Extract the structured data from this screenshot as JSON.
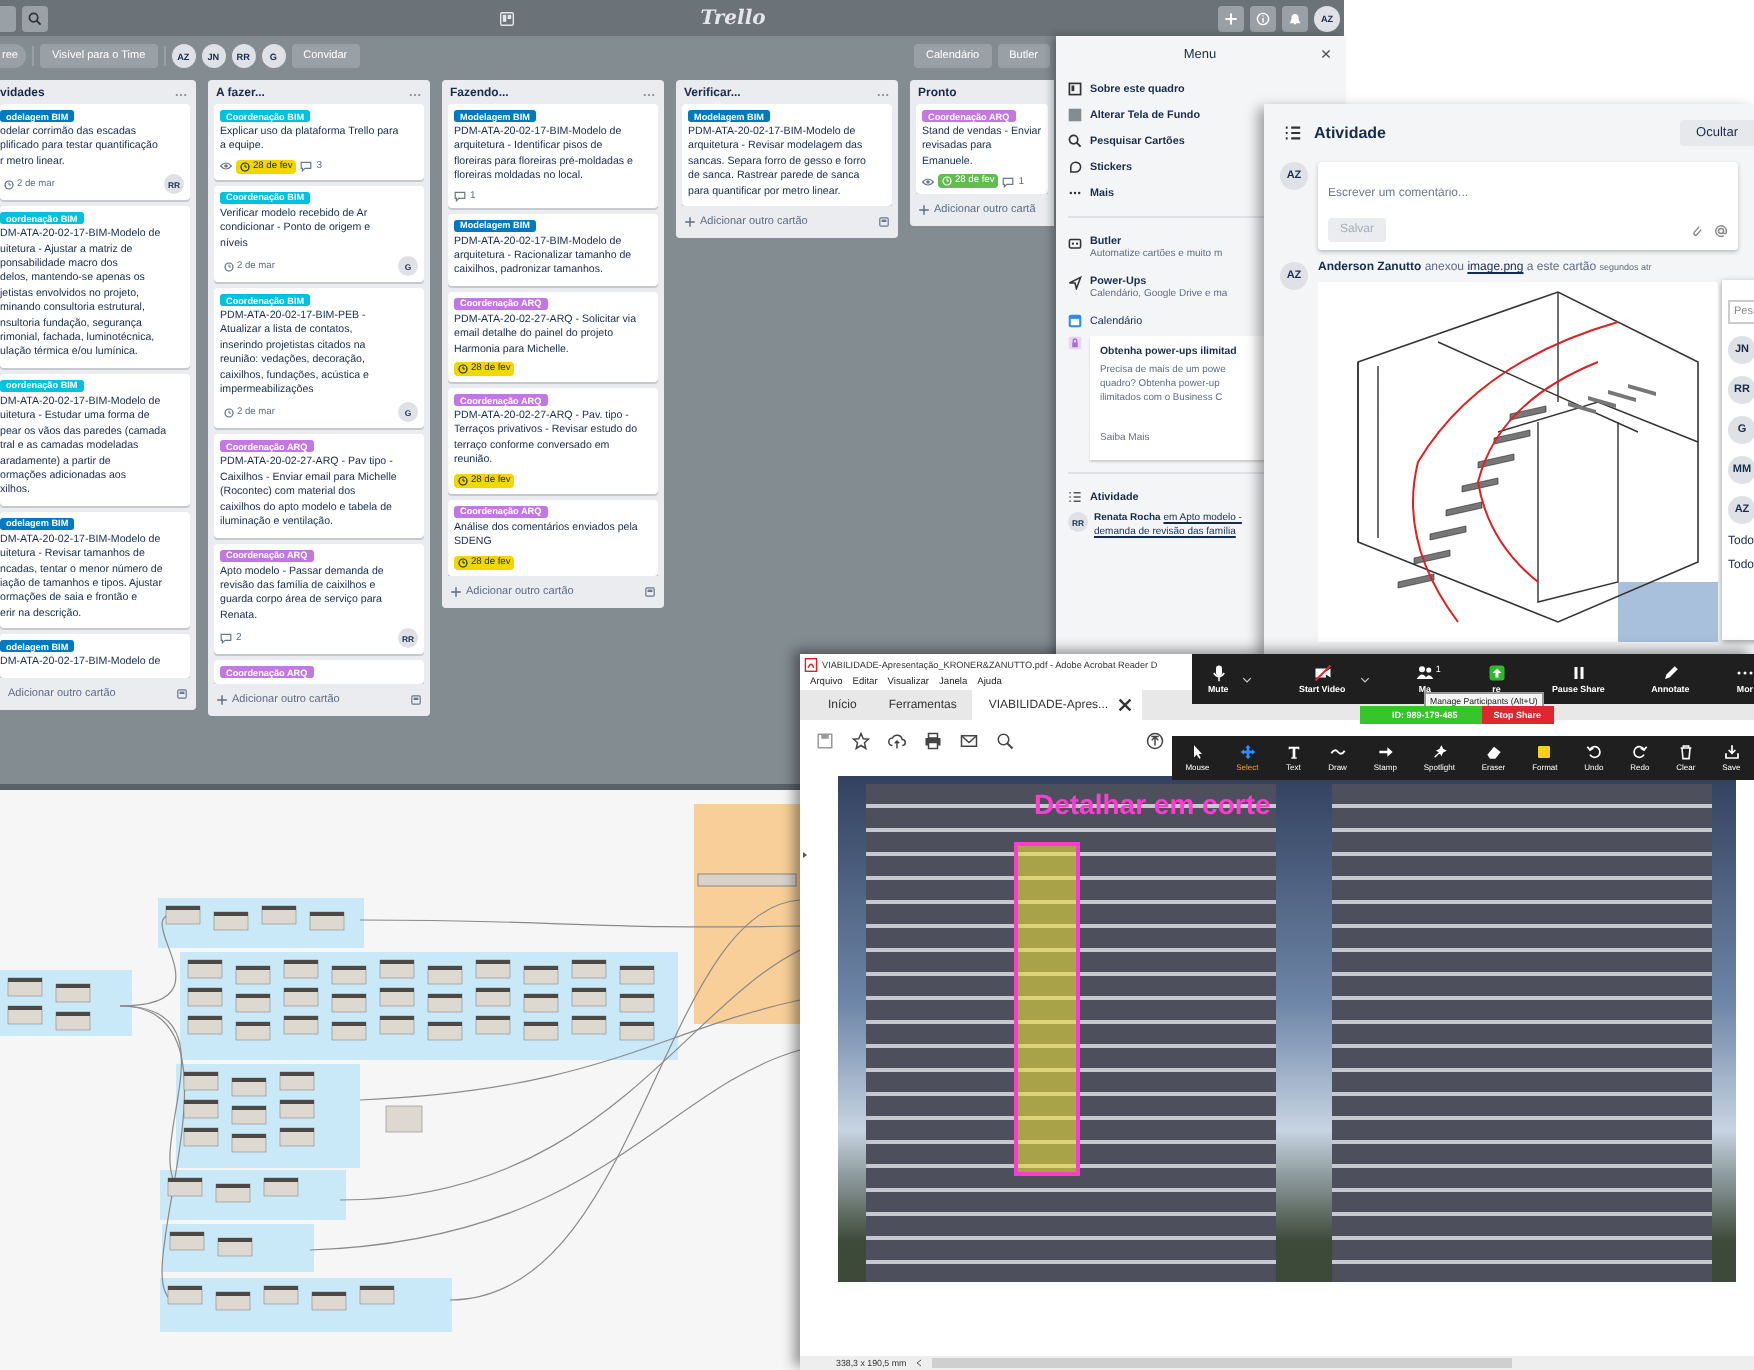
{
  "trello": {
    "header": {
      "logo": "Trello",
      "avatar": "AZ"
    },
    "board_bar": {
      "cut_button": "ree",
      "visibility": "Visível para o Time",
      "members": [
        "AZ",
        "JN",
        "RR",
        "G"
      ],
      "invite": "Convidar",
      "calendar": "Calendário",
      "butler": "Butler"
    },
    "lists": [
      {
        "title": "vidades",
        "plus": false,
        "add": "Adicionar outro cartão",
        "cards": [
          {
            "label": {
              "text": "odelagem BIM",
              "color": "#0079bf"
            },
            "text": "odelar corrimão das escadas\nplificado para testar quantificação\nr metro linear.",
            "due": {
              "text": "2 de mar",
              "kind": "plain"
            },
            "member": "RR"
          },
          {
            "label": {
              "text": "oordenação BIM",
              "color": "#00c2e0"
            },
            "text": "DM-ATA-20-02-17-BIM-Modelo de\nuitetura - Ajustar a matriz de\nponsabilidade macro dos\ndelos, mantendo-se apenas os\njetistas envolvidos no projeto,\nminando consultoria estrutural,\nnsultoria fundação, segurança\nrimonial, fachada, luminotécnica,\nulação térmica e/ou lumínica."
          },
          {
            "label": {
              "text": "oordenação BIM",
              "color": "#00c2e0"
            },
            "text": "DM-ATA-20-02-17-BIM-Modelo de\nuitetura - Estudar uma forma de\npear os vãos das paredes (camada\ntral e as camadas modeladas\naradamente) a partir de\normações adicionadas aos\nxilhos."
          },
          {
            "label": {
              "text": "odelagem BIM",
              "color": "#0079bf"
            },
            "text": "DM-ATA-20-02-17-BIM-Modelo de\nuitetura - Revisar tamanhos de\nncadas, tentar o menor número de\niação de tamanhos e tipos. Ajustar\normações de saia e frontão e\nerir na descrição."
          },
          {
            "label": {
              "text": "odelagem BIM",
              "color": "#0079bf"
            },
            "text": "DM-ATA-20-02-17-BIM-Modelo de"
          }
        ]
      },
      {
        "title": "A fazer...",
        "plus": true,
        "add": "Adicionar outro cartão",
        "cards": [
          {
            "label": {
              "text": "Coordenação BIM",
              "color": "#00c2e0"
            },
            "text": "Explicar uso da plataforma Trello para\na equipe.",
            "watch": true,
            "due": {
              "text": "28 de fev",
              "kind": "soon"
            },
            "comments": "3"
          },
          {
            "label": {
              "text": "Coordenação BIM",
              "color": "#00c2e0"
            },
            "text": "Verificar modelo recebido de Ar\ncondicionar - Ponto de origem e\nníveis",
            "due": {
              "text": "2 de mar",
              "kind": "plain"
            },
            "member": "G"
          },
          {
            "label": {
              "text": "Coordenação BIM",
              "color": "#00c2e0"
            },
            "text": "PDM-ATA-20-02-17-BIM-PEB -\nAtualizar a lista de contatos,\ninserindo projetistas citados na\nreunião: vedações, decoração,\ncaixilhos, fundações, acústica e\nimpermeabilizações",
            "due": {
              "text": "2 de mar",
              "kind": "plain"
            },
            "member": "G"
          },
          {
            "label": {
              "text": "Coordenação ARQ",
              "color": "#c377e0"
            },
            "text": "PDM-ATA-20-02-27-ARQ - Pav tipo -\nCaixilhos - Enviar email para Michelle\n(Rocontec) com material dos\ncaixilhos do apto modelo e tabela de\niluminação e ventilação."
          },
          {
            "label": {
              "text": "Coordenação ARQ",
              "color": "#c377e0"
            },
            "text": "Apto modelo - Passar demanda de\nrevisão das família de caixilhos e\nguarda corpo área de serviço para\nRenata.",
            "comments": "2",
            "member": "RR"
          },
          {
            "label": {
              "text": "Coordenação ARQ",
              "color": "#c377e0"
            }
          }
        ]
      },
      {
        "title": "Fazendo...",
        "plus": true,
        "add": "Adicionar outro cartão",
        "cards": [
          {
            "label": {
              "text": "Modelagem BIM",
              "color": "#0079bf"
            },
            "text": "PDM-ATA-20-02-17-BIM-Modelo de\narquitetura - Identificar pisos de\nfloreiras para floreiras pré-moldadas e\nfloreiras moldadas no local.",
            "comments": "1"
          },
          {
            "label": {
              "text": "Modelagem BIM",
              "color": "#0079bf"
            },
            "text": "PDM-ATA-20-02-17-BIM-Modelo de\narquitetura - Racionalizar tamanho de\ncaixilhos, padronizar tamanhos."
          },
          {
            "label": {
              "text": "Coordenação ARQ",
              "color": "#c377e0"
            },
            "text": "PDM-ATA-20-02-27-ARQ - Solicitar via\nemail detalhe do painel do projeto\nHarmonia para Michelle.",
            "due": {
              "text": "28 de fev",
              "kind": "soon"
            }
          },
          {
            "label": {
              "text": "Coordenação ARQ",
              "color": "#c377e0"
            },
            "text": "PDM-ATA-20-02-27-ARQ - Pav. tipo -\nTerraços privativos - Revisar estudo do\nterraço conforme conversado em\nreunião.",
            "due": {
              "text": "28 de fev",
              "kind": "soon"
            }
          },
          {
            "label": {
              "text": "Coordenação ARQ",
              "color": "#c377e0"
            },
            "text": "Análise dos comentários enviados pela\nSDENG",
            "due": {
              "text": "28 de fev",
              "kind": "soon"
            }
          }
        ]
      },
      {
        "title": "Verificar...",
        "plus": true,
        "add": "Adicionar outro cartão",
        "cards": [
          {
            "label": {
              "text": "Modelagem BIM",
              "color": "#0079bf"
            },
            "text": "PDM-ATA-20-02-17-BIM-Modelo de\narquitetura - Revisar modelagem das\nsancas. Separa forro de gesso e forro\nde sanca. Rastrear parede de sanca\npara quantificar por metro linear."
          }
        ]
      },
      {
        "title": "Pronto",
        "plus": true,
        "add": "Adicionar outro cartã",
        "cards": [
          {
            "label": {
              "text": "Coordenação ARQ",
              "color": "#c377e0"
            },
            "text": "Stand de vendas - Enviar\nrevisadas para Emanuele.",
            "watch": true,
            "due": {
              "text": "28 de fev",
              "kind": "done"
            },
            "comments": "1"
          }
        ]
      }
    ],
    "menu": {
      "title": "Menu",
      "items": [
        {
          "kind": "board",
          "label": "Sobre este quadro"
        },
        {
          "kind": "swatch",
          "label": "Alterar Tela de Fundo"
        },
        {
          "kind": "search",
          "label": "Pesquisar Cartões"
        },
        {
          "kind": "sticker",
          "label": "Stickers"
        },
        {
          "kind": "dots",
          "label": "Mais"
        }
      ],
      "sections": [
        {
          "kind": "robot",
          "title": "Butler",
          "subtitle": "Automatize cartões e muito m"
        },
        {
          "kind": "rocket",
          "title": "Power-Ups",
          "subtitle": "Calendário, Google Drive e ma"
        }
      ],
      "calendar": "Calendário",
      "promo": {
        "title": "Obtenha power-ups ilimitad",
        "text": "Precisa de mais de um powe\nquadro? Obtenha power-up\nilimitados com o Business C",
        "link": "Saiba Mais"
      },
      "activity": {
        "title": "Atividade",
        "avatar": "RR",
        "author": "Renata Rocha",
        "text": "em Apto modelo -\ndemanda de revisão das família"
      }
    }
  },
  "activity_window": {
    "title": "Atividade",
    "hide_button": "Ocultar",
    "comment": {
      "avatar": "AZ",
      "placeholder": "Escrever um comentário...",
      "save": "Salvar"
    },
    "entry": {
      "avatar": "AZ",
      "author": "Anderson Zanutto",
      "action": "anexou",
      "link": "image.png",
      "rest": "a este cartão",
      "time": "segundos atr"
    },
    "members_popup": {
      "search_placeholder": "Pes",
      "members": [
        "JN",
        "RR",
        "G",
        "MM",
        "AZ"
      ],
      "options": [
        "Todo",
        "Todo"
      ]
    }
  },
  "acrobat": {
    "title": "VIABILIDADE-Apresentação_KRONER&ZANUTTO.pdf - Adobe Acrobat Reader D",
    "menu": [
      "Arquivo",
      "Editar",
      "Visualizar",
      "Janela",
      "Ajuda"
    ],
    "tabs": [
      {
        "label": "Início",
        "selected": false
      },
      {
        "label": "Ferramentas",
        "selected": false
      },
      {
        "label": "VIABILIDADE-Apres...",
        "selected": true
      }
    ],
    "annotation": "Detalhar em corte",
    "page_size": "338,3 x 190,5 mm"
  },
  "zoom_controls": {
    "buttons": [
      {
        "kind": "mic",
        "label": "Mute",
        "caret": true
      },
      {
        "kind": "video-off",
        "label": "Start Video",
        "caret": true
      },
      {
        "kind": "participants",
        "label": "Ma",
        "count": "1",
        "caret": false
      },
      {
        "kind": "share",
        "label": "re",
        "caret": false
      },
      {
        "kind": "pause",
        "label": "Pause Share",
        "caret": false
      },
      {
        "kind": "annotate",
        "label": "Annotate",
        "caret": false
      },
      {
        "kind": "more",
        "label": "Mor",
        "caret": false
      }
    ],
    "tooltip": "Manage Participants (Alt+U)",
    "meeting_id": "ID: 989-179-485",
    "stop_share": "Stop Share",
    "tools": [
      {
        "kind": "mouse",
        "label": "Mouse",
        "selected": false
      },
      {
        "kind": "select",
        "label": "Select",
        "selected": true
      },
      {
        "kind": "text",
        "label": "Text",
        "selected": false
      },
      {
        "kind": "draw",
        "label": "Draw",
        "selected": false
      },
      {
        "kind": "stamp",
        "label": "Stamp",
        "selected": false
      },
      {
        "kind": "spotlight",
        "label": "Spotlight",
        "selected": false
      },
      {
        "kind": "eraser",
        "label": "Eraser",
        "selected": false
      },
      {
        "kind": "format",
        "label": "Format",
        "selected": false
      },
      {
        "kind": "undo",
        "label": "Undo",
        "selected": false
      },
      {
        "kind": "redo",
        "label": "Redo",
        "selected": false
      },
      {
        "kind": "clear",
        "label": "Clear",
        "selected": false
      },
      {
        "kind": "save",
        "label": "Save",
        "selected": false
      }
    ]
  }
}
